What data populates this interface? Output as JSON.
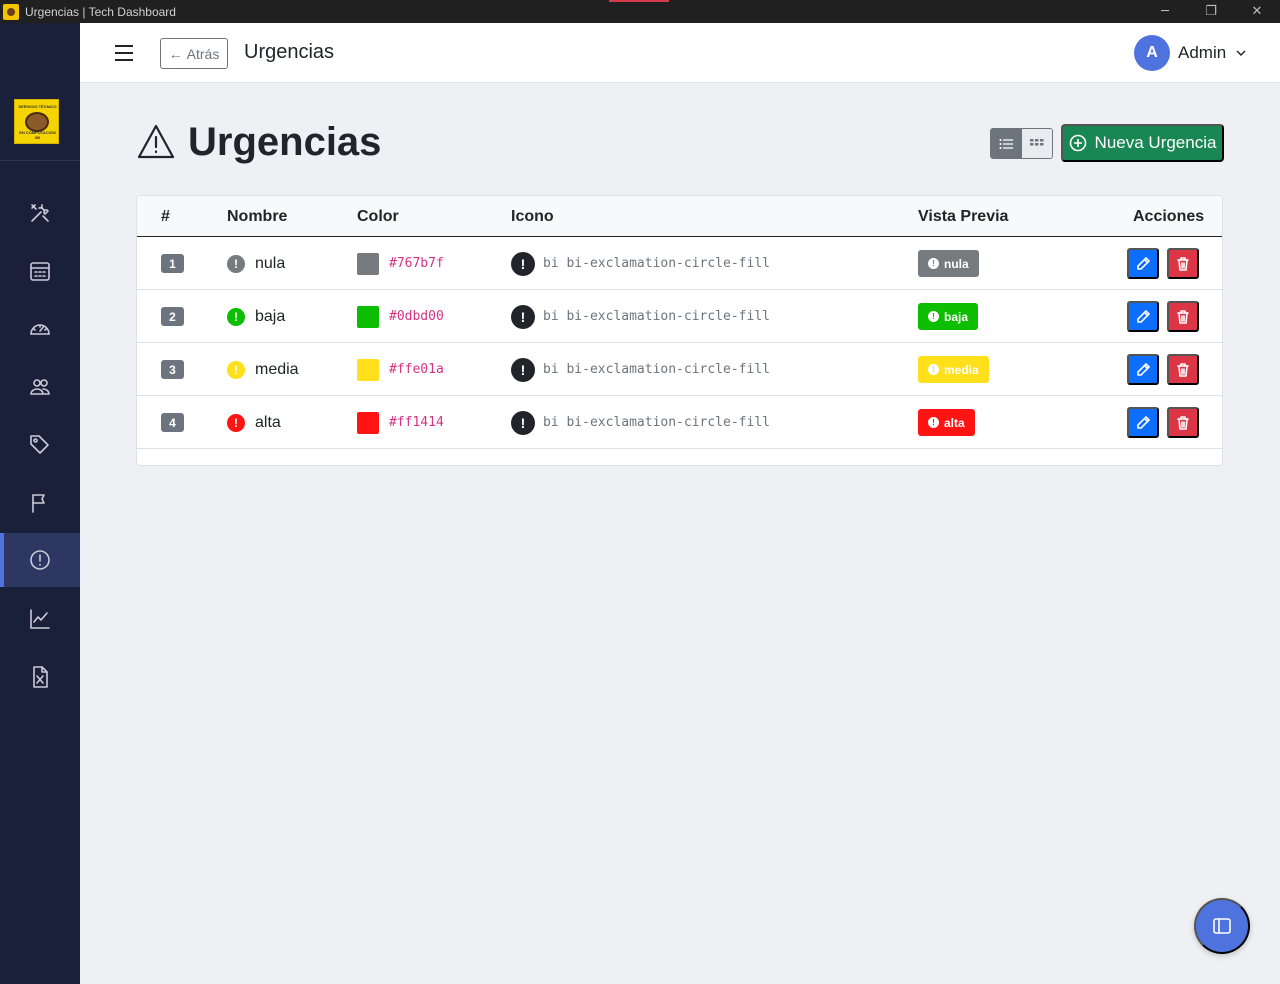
{
  "window": {
    "title": "Urgencias | Tech Dashboard",
    "minimize_glyph": "─",
    "maximize_glyph": "❐",
    "close_glyph": "✕",
    "accent_color": "#d23c4b"
  },
  "sidebar": {
    "logo_text": "SERVICIO TÉCNICO",
    "logo_subtext": "EN COMPUTACIÓN 6B",
    "background": "#1a1f3a",
    "items": [
      {
        "icon": "tools-icon",
        "active": false
      },
      {
        "icon": "calendar-icon",
        "active": false
      },
      {
        "icon": "speedometer-icon",
        "active": false
      },
      {
        "icon": "people-icon",
        "active": false
      },
      {
        "icon": "tags-icon",
        "active": false
      },
      {
        "icon": "flag-icon",
        "active": false
      },
      {
        "icon": "exclamation-circle-icon",
        "active": true
      },
      {
        "icon": "graph-up-icon",
        "active": false
      },
      {
        "icon": "file-excel-icon",
        "active": false
      }
    ]
  },
  "topbar": {
    "back_label": "Atrás",
    "back_arrow": "←",
    "title": "Urgencias",
    "user_initial": "A",
    "user_name": "Admin"
  },
  "page": {
    "heading": "Urgencias",
    "new_button_label": "Nueva Urgencia",
    "view_mode": "list"
  },
  "table": {
    "headers": {
      "index": "#",
      "name": "Nombre",
      "color": "Color",
      "icon": "Icono",
      "preview": "Vista Previa",
      "actions": "Acciones"
    },
    "rows": [
      {
        "index": "1",
        "name": "nula",
        "color": "#767b7f",
        "icon": "bi bi-exclamation-circle-fill",
        "preview": "nula"
      },
      {
        "index": "2",
        "name": "baja",
        "color": "#0dbd00",
        "icon": "bi bi-exclamation-circle-fill",
        "preview": "baja"
      },
      {
        "index": "3",
        "name": "media",
        "color": "#ffe01a",
        "icon": "bi bi-exclamation-circle-fill",
        "preview": "media"
      },
      {
        "index": "4",
        "name": "alta",
        "color": "#ff1414",
        "icon": "bi bi-exclamation-circle-fill",
        "preview": "alta"
      }
    ],
    "exclamation_glyph": "!"
  },
  "colors": {
    "primary": "#4e73df",
    "success": "#198754",
    "edit": "#0d6efd",
    "delete": "#dc3545",
    "secondary": "#6c757d"
  }
}
